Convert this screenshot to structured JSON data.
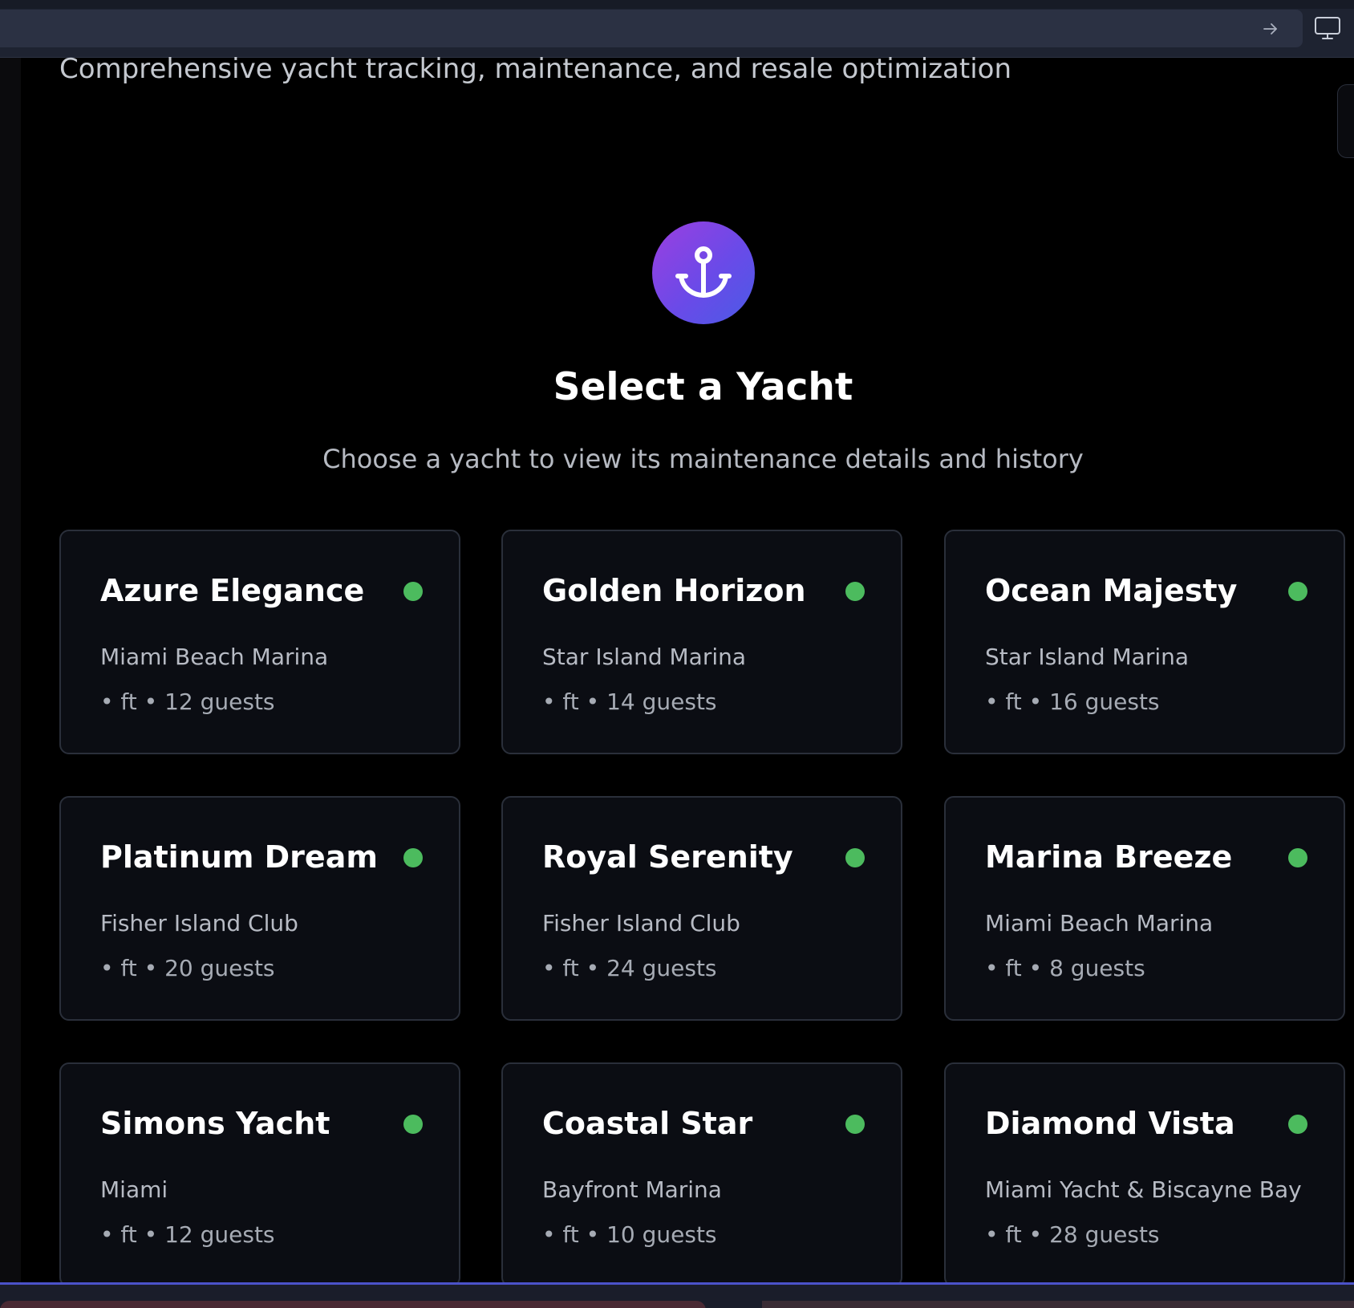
{
  "header": {
    "subtitle": "Comprehensive yacht tracking, maintenance, and resale optimization"
  },
  "main": {
    "title": "Select a Yacht",
    "description": "Choose a yacht to view its maintenance details and history"
  },
  "yachts": [
    {
      "name": "Azure Elegance",
      "location": "Miami Beach Marina",
      "meta": "• ft • 12 guests",
      "status_color": "#4cbb5e"
    },
    {
      "name": "Golden Horizon",
      "location": "Star Island Marina",
      "meta": "• ft • 14 guests",
      "status_color": "#4cbb5e"
    },
    {
      "name": "Ocean Majesty",
      "location": "Star Island Marina",
      "meta": "• ft • 16 guests",
      "status_color": "#4cbb5e"
    },
    {
      "name": "Platinum Dream",
      "location": "Fisher Island Club",
      "meta": "• ft • 20 guests",
      "status_color": "#4cbb5e"
    },
    {
      "name": "Royal Serenity",
      "location": "Fisher Island Club",
      "meta": "• ft • 24 guests",
      "status_color": "#4cbb5e"
    },
    {
      "name": "Marina Breeze",
      "location": "Miami Beach Marina",
      "meta": "• ft • 8 guests",
      "status_color": "#4cbb5e"
    },
    {
      "name": "Simons Yacht",
      "location": "Miami",
      "meta": "• ft • 12 guests",
      "status_color": "#4cbb5e"
    },
    {
      "name": "Coastal Star",
      "location": "Bayfront Marina",
      "meta": "• ft • 10 guests",
      "status_color": "#4cbb5e"
    },
    {
      "name": "Diamond Vista",
      "location": "Miami Yacht & Biscayne Bay",
      "meta": "• ft • 28 guests",
      "status_color": "#4cbb5e"
    }
  ],
  "icons": {
    "hero": "anchor-icon",
    "go": "arrow-right-icon",
    "display": "monitor-icon"
  },
  "colors": {
    "accent_gradient_start": "#9b3fe0",
    "accent_gradient_end": "#4a5be6",
    "status_active": "#4cbb5e",
    "card_background": "#0b0d13",
    "page_background": "#000000"
  }
}
